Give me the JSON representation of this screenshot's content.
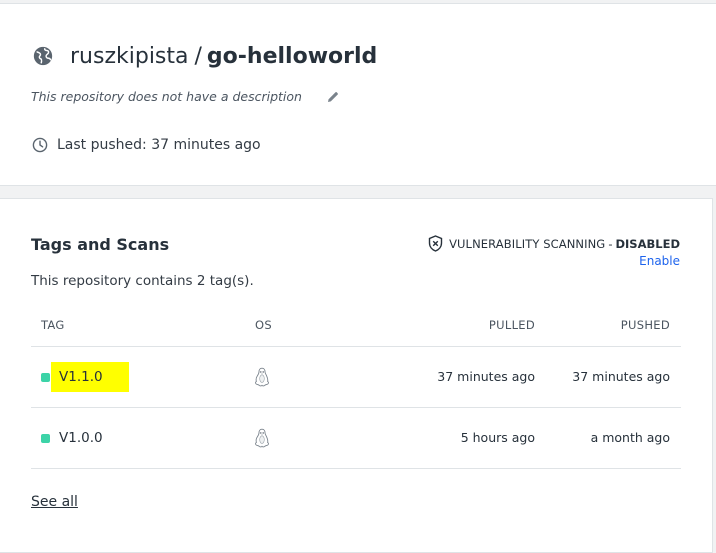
{
  "repository": {
    "namespace": "ruszkipista",
    "separator": "/",
    "name": "go-helloworld",
    "description": "This repository does not have a description",
    "last_pushed": "Last pushed: 37 minutes ago",
    "icons": {
      "visibility": "globe-icon",
      "edit": "pencil-icon",
      "time": "clock-icon"
    }
  },
  "tags_section": {
    "title": "Tags and Scans",
    "scanning_label": "VULNERABILITY SCANNING",
    "scanning_separator": "-",
    "scanning_status": "DISABLED",
    "enable_link": "Enable",
    "summary": "This repository contains 2 tag(s).",
    "columns": {
      "tag": "TAG",
      "os": "OS",
      "pulled": "PULLED",
      "pushed": "PUSHED"
    },
    "rows": [
      {
        "tag": "V1.1.0",
        "os": "linux-icon",
        "pulled": "37 minutes ago",
        "pushed": "37 minutes ago",
        "highlighted": true
      },
      {
        "tag": "V1.0.0",
        "os": "linux-icon",
        "pulled": "5 hours ago",
        "pushed": "a month ago",
        "highlighted": false
      }
    ],
    "see_all": "See all"
  },
  "colors": {
    "status_dot": "#3cd3a7",
    "highlight": "#ffff00",
    "link": "#1d63ed",
    "text": "#27313b"
  }
}
